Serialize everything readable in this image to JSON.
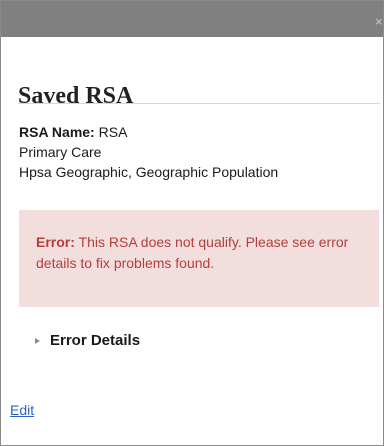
{
  "window": {
    "close_glyph": "×"
  },
  "header": {
    "title": "Saved RSA"
  },
  "info": {
    "name_label": "RSA Name:",
    "name_value": "RSA",
    "line2": "Primary Care",
    "line3": "Hpsa Geographic, Geographic Population"
  },
  "error": {
    "label": "Error:",
    "message": "This RSA does not qualify. Please see error details to fix problems found."
  },
  "details": {
    "label": "Error Details"
  },
  "actions": {
    "edit": "Edit"
  },
  "colors": {
    "titlebar": "#808080",
    "error_bg": "#f3dede",
    "error_text": "#b33f3a",
    "link": "#2b63c5"
  },
  "icons": {
    "details_toggle": "caret-right-icon"
  }
}
